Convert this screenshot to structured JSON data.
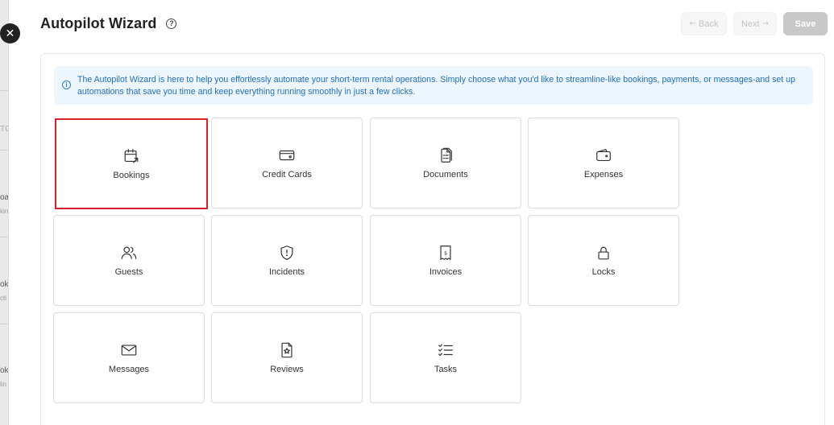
{
  "background_fragments": [
    "TC",
    "oa",
    "kin",
    "ok",
    "cti",
    "ok",
    "lin"
  ],
  "modal": {
    "close_glyph": "✕",
    "title": "Autopilot Wizard",
    "help_glyph": "?",
    "actions": {
      "back_arrow": "←",
      "back_label": "Back",
      "next_label": "Next",
      "next_arrow": "→",
      "save_label": "Save"
    },
    "info": {
      "icon_glyph": "i",
      "text": "The Autopilot Wizard is here to help you effortlessly automate your short-term rental operations. Simply choose what you'd like to streamline-like bookings, payments, or messages-and set up automations that save you time and keep everything running smoothly in just a few clicks."
    },
    "categories": [
      {
        "label": "Bookings",
        "icon": "calendar-arrow-icon",
        "selected": true
      },
      {
        "label": "Credit Cards",
        "icon": "credit-card-icon"
      },
      {
        "label": "Documents",
        "icon": "documents-icon"
      },
      {
        "label": "Expenses",
        "icon": "wallet-icon"
      },
      {
        "label": "Guests",
        "icon": "users-icon"
      },
      {
        "label": "Incidents",
        "icon": "shield-alert-icon"
      },
      {
        "label": "Invoices",
        "icon": "receipt-icon"
      },
      {
        "label": "Locks",
        "icon": "lock-icon"
      },
      {
        "label": "Messages",
        "icon": "mail-icon"
      },
      {
        "label": "Reviews",
        "icon": "star-file-icon"
      },
      {
        "label": "Tasks",
        "icon": "checklist-icon"
      }
    ],
    "colors": {
      "info_bg": "#eef6fd",
      "info_text": "#1f6fbf",
      "selected_border": "#d6212b",
      "save_bg": "#c8c8c8"
    }
  }
}
